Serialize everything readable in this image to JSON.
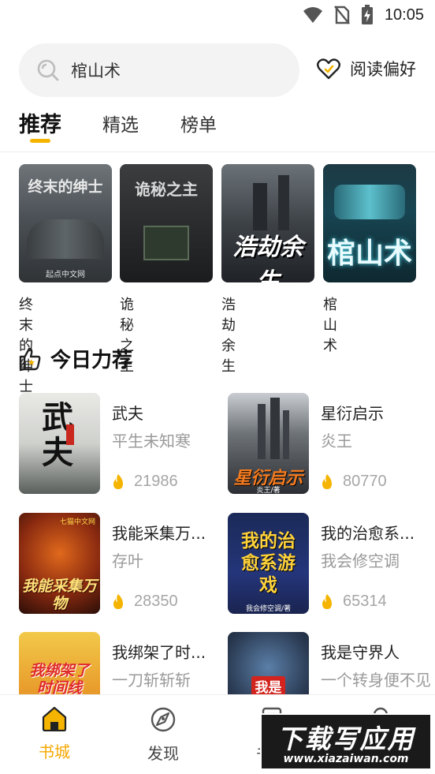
{
  "status_bar": {
    "time": "10:05"
  },
  "search": {
    "query": "棺山术"
  },
  "preferences": {
    "label": "阅读偏好"
  },
  "tabs": [
    {
      "label": "推荐",
      "active": true
    },
    {
      "label": "精选",
      "active": false
    },
    {
      "label": "榜单",
      "active": false
    }
  ],
  "featured": [
    {
      "name": "终末的绅士",
      "cover_text": "终末的绅士",
      "cover_sub": "起点中文网"
    },
    {
      "name": "诡秘之主",
      "cover_text": "诡秘之主",
      "cover_sub": ""
    },
    {
      "name": "浩劫余生",
      "cover_text": "浩劫余生",
      "cover_sub": ""
    },
    {
      "name": "棺山术",
      "cover_text": "棺山术",
      "cover_sub": ""
    }
  ],
  "section": {
    "title": "今日力荐"
  },
  "recommendations": [
    {
      "title": "武夫",
      "author": "平生未知寒",
      "heat": "21986",
      "cover_text": "武夫"
    },
    {
      "title": "星衍启示",
      "author": "炎王",
      "heat": "80770",
      "cover_text": "星衍启示",
      "cover_sub": "炎王/著"
    },
    {
      "title": "我能采集万...",
      "author": "存叶",
      "heat": "28350",
      "cover_text": "我能采集万物",
      "cover_sub": "七猫中文网"
    },
    {
      "title": "我的治愈系...",
      "author": "我会修空调",
      "heat": "65314",
      "cover_text": "我的治愈系游戏",
      "cover_sub": "我会修空调/著"
    },
    {
      "title": "我绑架了时...",
      "author": "一刀斩斩斩",
      "heat": "",
      "cover_text": "我绑架了时间线"
    },
    {
      "title": "我是守界人",
      "author": "一个转身便不见",
      "heat": "",
      "cover_text": "我是"
    }
  ],
  "bottom_nav": [
    {
      "label": "书城",
      "active": true,
      "icon": "home-icon"
    },
    {
      "label": "发现",
      "active": false,
      "icon": "discover-icon"
    },
    {
      "label": "书架",
      "active": false,
      "icon": "bookshelf-icon"
    },
    {
      "label": "我的",
      "active": false,
      "icon": "profile-icon"
    }
  ],
  "watermark": {
    "main": "下载写应用",
    "sub": "www.xiazaiwan.com"
  },
  "colors": {
    "accent": "#f5b400",
    "muted": "#9a9a9a"
  }
}
